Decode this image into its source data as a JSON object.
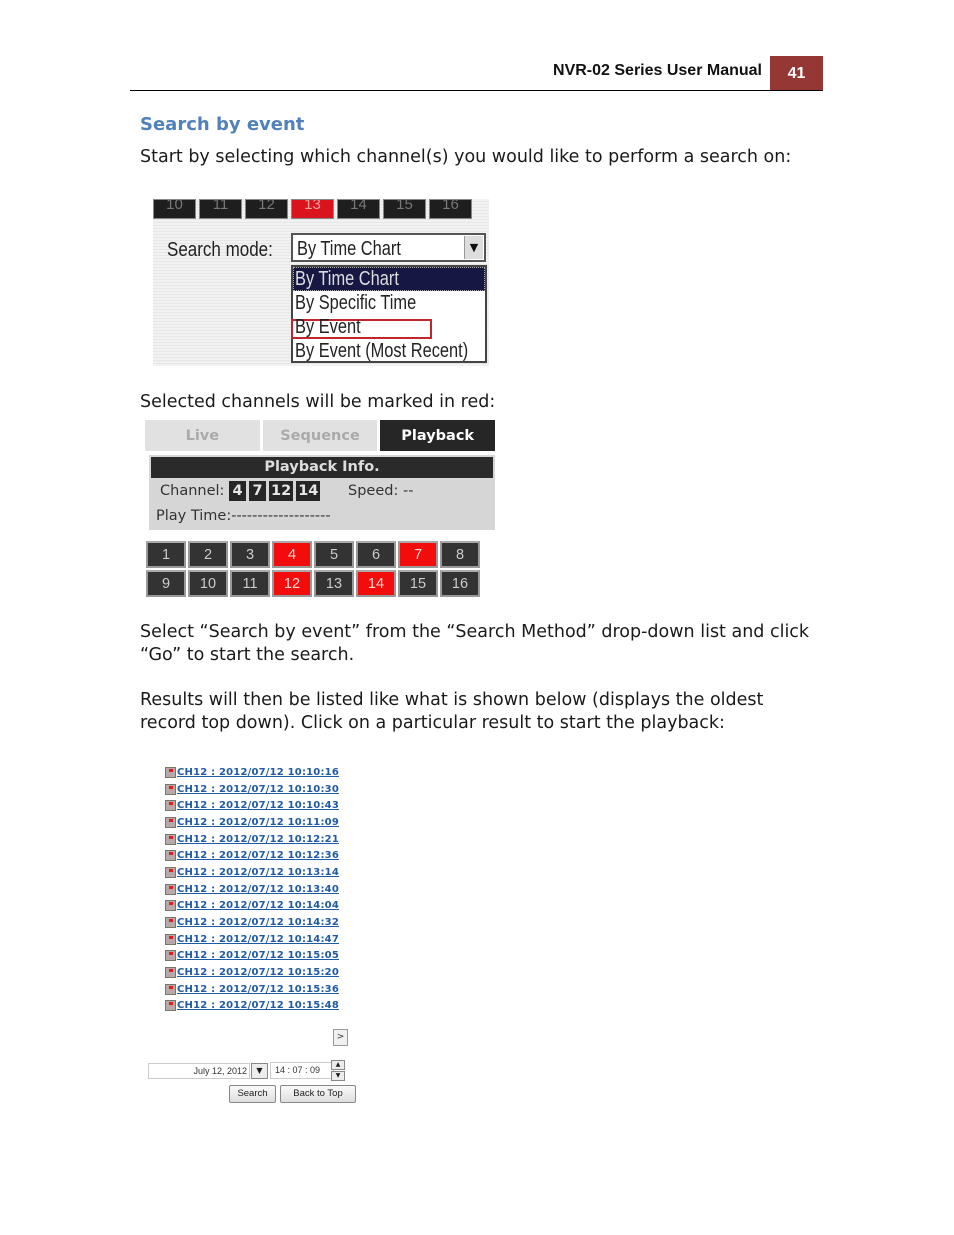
{
  "header": {
    "manual_title": "NVR-02 Series User Manual",
    "page_number": "41"
  },
  "section": {
    "heading": "Search by event",
    "intro_text": "Start by selecting which channel(s) you would like to perform a search on:",
    "selected_channels_text": "Selected channels will be marked in red:",
    "select_instruction": "Select “Search by event” from the “Search Method” drop-down list and click “Go” to start the search.",
    "results_text": "Results will then be listed like what is shown below (displays the oldest record top down). Click on a particular result to start the playback:"
  },
  "figure_search_mode": {
    "channel_tabs": [
      {
        "label": "10",
        "selected": false
      },
      {
        "label": "11",
        "selected": false
      },
      {
        "label": "12",
        "selected": false
      },
      {
        "label": "13",
        "selected": true
      },
      {
        "label": "14",
        "selected": false
      },
      {
        "label": "15",
        "selected": false
      },
      {
        "label": "16",
        "selected": false
      }
    ],
    "search_mode_label": "Search mode:",
    "selected_value": "By Time Chart",
    "options": [
      "By Time Chart",
      "By Specific Time",
      "By Event",
      "By Event (Most Recent)"
    ],
    "highlighted_option": "By Time Chart",
    "outlined_option": "By Event"
  },
  "figure_playback": {
    "tabs": [
      "Live",
      "Sequence",
      "Playback"
    ],
    "active_tab": "Playback",
    "info_title": "Playback Info.",
    "channel_label": "Channel:",
    "active_channels": [
      "4",
      "7",
      "12",
      "14"
    ],
    "speed_label": "Speed:",
    "speed_value": "--",
    "play_time_label": "Play Time:",
    "play_time_value": "-------------------",
    "channel_grid": [
      {
        "label": "1",
        "selected": false
      },
      {
        "label": "2",
        "selected": false
      },
      {
        "label": "3",
        "selected": false
      },
      {
        "label": "4",
        "selected": true
      },
      {
        "label": "5",
        "selected": false
      },
      {
        "label": "6",
        "selected": false
      },
      {
        "label": "7",
        "selected": true
      },
      {
        "label": "8",
        "selected": false
      },
      {
        "label": "9",
        "selected": false
      },
      {
        "label": "10",
        "selected": false
      },
      {
        "label": "11",
        "selected": false
      },
      {
        "label": "12",
        "selected": true
      },
      {
        "label": "13",
        "selected": false
      },
      {
        "label": "14",
        "selected": true
      },
      {
        "label": "15",
        "selected": false
      },
      {
        "label": "16",
        "selected": false
      }
    ]
  },
  "results": [
    "CH12 : 2012/07/12 10:10:16",
    "CH12 : 2012/07/12 10:10:30",
    "CH12 : 2012/07/12 10:10:43",
    "CH12 : 2012/07/12 10:11:09",
    "CH12 : 2012/07/12 10:12:21",
    "CH12 : 2012/07/12 10:12:36",
    "CH12 : 2012/07/12 10:13:14",
    "CH12 : 2012/07/12 10:13:40",
    "CH12 : 2012/07/12 10:14:04",
    "CH12 : 2012/07/12 10:14:32",
    "CH12 : 2012/07/12 10:14:47",
    "CH12 : 2012/07/12 10:15:05",
    "CH12 : 2012/07/12 10:15:20",
    "CH12 : 2012/07/12 10:15:36",
    "CH12 : 2012/07/12 10:15:48"
  ],
  "result_icon": "video-record-icon",
  "controls": {
    "next_page_label": ">",
    "date_value": "July 12, 2012",
    "date_dropdown_icon": "▼",
    "time_value": "14 :  07 :  09",
    "spin_up_icon": "▲",
    "spin_down_icon": "▼",
    "search_button": "Search",
    "back_to_top_button": "Back to Top"
  },
  "colors": {
    "heading_blue": "#4f81bd",
    "page_badge": "#953735",
    "selected_red": "#f20c0c",
    "link_blue": "#1f5aa6"
  }
}
